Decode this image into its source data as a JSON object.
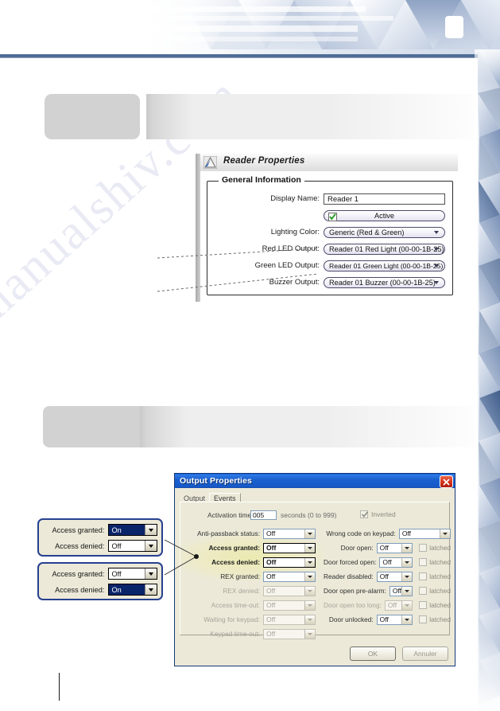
{
  "document": {
    "page_number_placeholder": "",
    "watermark": "manualshiv.com"
  },
  "reader_properties": {
    "title": "Reader Properties",
    "title_icon": "mountain-triangle-icon",
    "group_title": "General Information",
    "fields": [
      {
        "label": "Display Name:",
        "value": "Reader 1",
        "type": "textbox"
      },
      {
        "label": "",
        "value": "Active",
        "type": "checkbox-pill",
        "checked": true
      },
      {
        "label": "Lighting Color:",
        "value": "Generic (Red & Green)",
        "type": "dropdown"
      },
      {
        "label": "Red LED Output:",
        "value": "Reader 01 Red Light (00-00-1B-25)",
        "type": "dropdown"
      },
      {
        "label": "Green LED Output:",
        "value": "Reader 01 Green Light (00-00-1B-25)",
        "type": "dropdown"
      },
      {
        "label": "Buzzer Output:",
        "value": "Reader 01 Buzzer (00-00-1B-25)",
        "type": "dropdown"
      }
    ]
  },
  "output_properties": {
    "title": "Output Properties",
    "close_icon": "close-x-icon",
    "tabs": [
      {
        "label": "Output",
        "active": false
      },
      {
        "label": "Events",
        "active": true
      }
    ],
    "activation": {
      "label": "Activation time:",
      "value": "005",
      "suffix": "seconds (0 to 999)",
      "inverted_label": "Inverted",
      "inverted_checked": true
    },
    "left_column": [
      {
        "label": "Anti-passback status:",
        "value": "Off",
        "disabled": false,
        "highlighted": false
      },
      {
        "label": "Access granted:",
        "value": "Off",
        "disabled": false,
        "highlighted": true
      },
      {
        "label": "Access denied:",
        "value": "Off",
        "disabled": false,
        "highlighted": true
      },
      {
        "label": "REX granted:",
        "value": "Off",
        "disabled": false,
        "highlighted": false
      },
      {
        "label": "REX denied:",
        "value": "Off",
        "disabled": true,
        "highlighted": false
      },
      {
        "label": "Access time-out:",
        "value": "Off",
        "disabled": true,
        "highlighted": false
      },
      {
        "label": "Waiting for keypad:",
        "value": "Off",
        "disabled": true,
        "highlighted": false
      },
      {
        "label": "Keypad time-out:",
        "value": "Off",
        "disabled": true,
        "highlighted": false
      }
    ],
    "right_column": [
      {
        "label": "Wrong code on keypad:",
        "value": "Off",
        "disabled": false,
        "latched": null
      },
      {
        "label": "Door open:",
        "value": "Off",
        "disabled": false,
        "latched": false,
        "latched_label": "latched"
      },
      {
        "label": "Door forced open:",
        "value": "Off",
        "disabled": false,
        "latched": false,
        "latched_label": "latched"
      },
      {
        "label": "Reader disabled:",
        "value": "Off",
        "disabled": false,
        "latched": false,
        "latched_label": "latched"
      },
      {
        "label": "Door open pre-alarm:",
        "value": "Off",
        "disabled": false,
        "latched": false,
        "latched_label": "latched"
      },
      {
        "label": "Door open too long:",
        "value": "Off",
        "disabled": true,
        "latched": false,
        "latched_label": "latched"
      },
      {
        "label": "Door unlocked:",
        "value": "Off",
        "disabled": false,
        "latched": false,
        "latched_label": "latched"
      }
    ],
    "buttons": {
      "ok": "OK",
      "cancel": "Annuler"
    }
  },
  "callouts": [
    {
      "id": "callout-granted-on",
      "rows": [
        {
          "label": "Access granted:",
          "value": "On",
          "selected": true
        },
        {
          "label": "Access denied:",
          "value": "Off",
          "selected": false
        }
      ]
    },
    {
      "id": "callout-denied-on",
      "rows": [
        {
          "label": "Access granted:",
          "value": "Off",
          "selected": false
        },
        {
          "label": "Access denied:",
          "value": "On",
          "selected": true
        }
      ]
    }
  ],
  "colors": {
    "header_rule": "#45628c",
    "callout_border": "#26418f",
    "xp_titlebar": "#165ac8",
    "selection_blue": "#0a246a",
    "redact_gray": "#d2d2d2",
    "close_red": "#d5331c"
  }
}
